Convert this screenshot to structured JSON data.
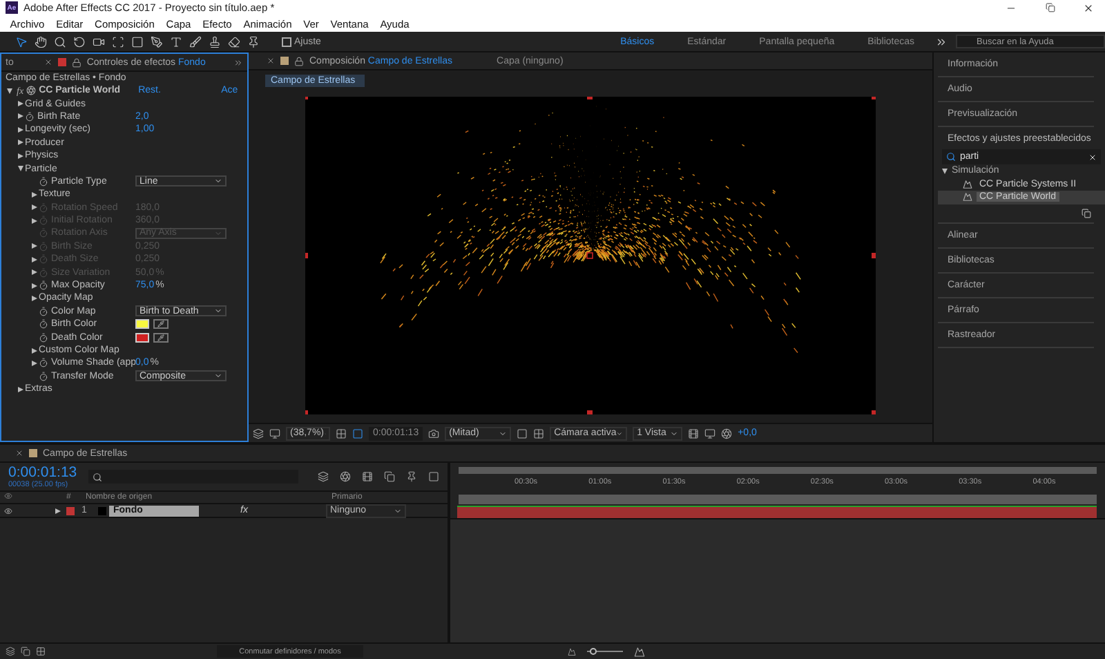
{
  "window": {
    "app_icon": "Ae",
    "title": "Adobe After Effects CC 2017 - Proyecto sin título.aep *"
  },
  "menu": [
    "Archivo",
    "Editar",
    "Composición",
    "Capa",
    "Efecto",
    "Animación",
    "Ver",
    "Ventana",
    "Ayuda"
  ],
  "toolbar": {
    "snap": {
      "label": "Ajuste",
      "checked": false
    },
    "workspaces": [
      {
        "label": "Básicos",
        "selected": true
      },
      {
        "label": "Estándar",
        "selected": false
      },
      {
        "label": "Pantalla pequeña",
        "selected": false
      },
      {
        "label": "Bibliotecas",
        "selected": false
      }
    ],
    "help_search": {
      "placeholder": "Buscar en la Ayuda"
    }
  },
  "effect_controls": {
    "prev_tab": "to",
    "tab_prefix": "Controles de efectos",
    "tab_layer": "Fondo",
    "path": "Campo de Estrellas • Fondo",
    "effect": {
      "fx": "fx",
      "name": "CC Particle World",
      "reset": "Rest.",
      "about": "Ace",
      "expanded": true,
      "properties": [
        {
          "kind": "group",
          "label": "Grid & Guides",
          "expanded": false
        },
        {
          "kind": "number",
          "label": "Birth Rate",
          "value": "2,0",
          "expanded": false,
          "stopwatch": true,
          "disabled": false
        },
        {
          "kind": "number",
          "label": "Longevity (sec)",
          "value": "1,00",
          "expanded": false,
          "stopwatch": false,
          "disabled": false
        },
        {
          "kind": "group",
          "label": "Producer",
          "expanded": false
        },
        {
          "kind": "group",
          "label": "Physics",
          "expanded": false
        },
        {
          "kind": "group",
          "label": "Particle",
          "expanded": true,
          "children": [
            {
              "kind": "dropdown",
              "label": "Particle Type",
              "value": "Line",
              "stopwatch": true,
              "disabled": false
            },
            {
              "kind": "group",
              "label": "Texture",
              "expanded": false
            },
            {
              "kind": "number",
              "label": "Rotation Speed",
              "value": "180,0",
              "expanded": false,
              "stopwatch": true,
              "disabled": true
            },
            {
              "kind": "number",
              "label": "Initial Rotation",
              "value": "360,0",
              "expanded": false,
              "stopwatch": true,
              "disabled": true
            },
            {
              "kind": "dropdown",
              "label": "Rotation Axis",
              "value": "Any Axis",
              "stopwatch": true,
              "disabled": true
            },
            {
              "kind": "number",
              "label": "Birth Size",
              "value": "0,250",
              "expanded": false,
              "stopwatch": true,
              "disabled": true
            },
            {
              "kind": "number",
              "label": "Death Size",
              "value": "0,250",
              "expanded": false,
              "stopwatch": true,
              "disabled": true
            },
            {
              "kind": "number",
              "label": "Size Variation",
              "value": "50,0",
              "unit": "%",
              "expanded": false,
              "stopwatch": true,
              "disabled": true
            },
            {
              "kind": "number",
              "label": "Max Opacity",
              "value": "75,0",
              "unit": "%",
              "expanded": false,
              "stopwatch": true,
              "disabled": false
            },
            {
              "kind": "group",
              "label": "Opacity Map",
              "expanded": false
            },
            {
              "kind": "dropdown",
              "label": "Color Map",
              "value": "Birth to Death",
              "stopwatch": true,
              "disabled": false
            },
            {
              "kind": "color",
              "label": "Birth Color",
              "color": "#f8f840",
              "stopwatch": true,
              "disabled": false
            },
            {
              "kind": "color",
              "label": "Death Color",
              "color": "#d02020",
              "stopwatch": true,
              "disabled": false
            },
            {
              "kind": "group",
              "label": "Custom Color Map",
              "expanded": false
            },
            {
              "kind": "number",
              "label": "Volume Shade (app",
              "value": "0,0",
              "unit": "%",
              "expanded": false,
              "stopwatch": true,
              "disabled": false
            },
            {
              "kind": "dropdown",
              "label": "Transfer Mode",
              "value": "Composite",
              "stopwatch": true,
              "disabled": false
            }
          ]
        },
        {
          "kind": "group",
          "label": "Extras",
          "expanded": false
        }
      ]
    }
  },
  "composition": {
    "tab_prefix": "Composición",
    "tab_comp": "Campo de Estrellas",
    "layer_tab": "Capa (ninguno)",
    "view_tab": "Campo de Estrellas",
    "footer": {
      "zoom": "(38,7%)",
      "time": "0:00:01:13",
      "resolution": "(Mitad)",
      "camera": "Cámara activa",
      "views": "1 Vista",
      "exposure": "+0,0"
    }
  },
  "right_panel": {
    "sections_top": [
      "Información",
      "Audio",
      "Previsualización"
    ],
    "effects": {
      "title": "Efectos y ajustes preestablecidos",
      "search": "parti",
      "tree": [
        {
          "label": "Simulación",
          "expanded": true,
          "children": [
            {
              "label": "CC Particle Systems II",
              "selected": false
            },
            {
              "label": "CC Particle World",
              "selected": true
            }
          ]
        }
      ]
    },
    "sections_bottom": [
      "Alinear",
      "Bibliotecas",
      "Carácter",
      "Párrafo",
      "Rastreador"
    ]
  },
  "timeline": {
    "tab": "Campo de Estrellas",
    "timecode": "0:00:01:13",
    "frames": "00038 (25.00 fps)",
    "columns": {
      "number": "#",
      "source": "Nombre de origen",
      "parent": "Primario"
    },
    "layers": [
      {
        "number": "1",
        "name": "Fondo",
        "color": "#c03434",
        "visible": true,
        "selected": true,
        "fx": "fx",
        "effects_on": true,
        "parent": "Ninguno"
      }
    ],
    "zoom": {
      "level": 0.15
    },
    "ruler": [
      "00:30s",
      "01:00s",
      "01:30s",
      "02:00s",
      "02:30s",
      "03:00s",
      "03:30s",
      "04:00s"
    ],
    "toggle": "Conmutar definidores / modos"
  }
}
